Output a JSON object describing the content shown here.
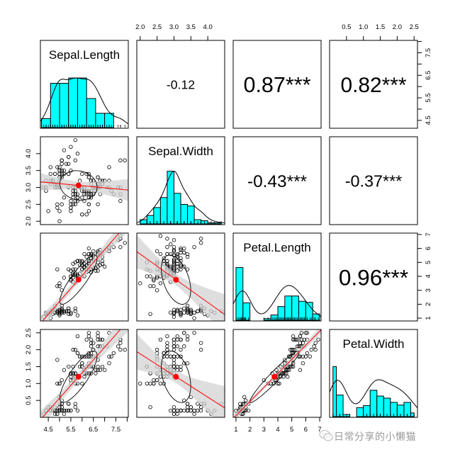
{
  "chart_data": {
    "type": "scatter",
    "title": "",
    "variables": [
      "Sepal.Length",
      "Sepal.Width",
      "Petal.Length",
      "Petal.Width"
    ],
    "ranges": {
      "Sepal.Length": [
        4.15,
        8.05
      ],
      "Sepal.Width": [
        1.9,
        4.5
      ],
      "Petal.Length": [
        0.8,
        7.1
      ],
      "Petal.Width": [
        0.0,
        2.6
      ]
    },
    "ticks": {
      "Sepal.Length": {
        "major": [
          4.5,
          5.0,
          5.5,
          6.0,
          6.5,
          7.0,
          7.5,
          8.0
        ],
        "labels": [
          "4.5",
          "5.5",
          "6.5",
          "7.5"
        ],
        "label_values": [
          4.5,
          5.5,
          6.5,
          7.5
        ]
      },
      "Sepal.Width": {
        "major": [
          2.0,
          2.5,
          3.0,
          3.5,
          4.0
        ],
        "labels": [
          "2.0",
          "2.5",
          "3.0",
          "3.5",
          "4.0"
        ],
        "label_values": [
          2.0,
          2.5,
          3.0,
          3.5,
          4.0
        ]
      },
      "Petal.Length": {
        "major": [
          1,
          2,
          3,
          4,
          5,
          6,
          7
        ],
        "labels": [
          "1",
          "2",
          "3",
          "4",
          "5",
          "6",
          "7"
        ],
        "label_values": [
          1,
          2,
          3,
          4,
          5,
          6,
          7
        ]
      },
      "Petal.Width": {
        "major": [
          0.5,
          1.0,
          1.5,
          2.0,
          2.5
        ],
        "labels": [
          "0.5",
          "1.0",
          "1.5",
          "2.0",
          "2.5"
        ],
        "label_values": [
          0.5,
          1.0,
          1.5,
          2.0,
          2.5
        ]
      }
    },
    "correlations": [
      {
        "row": 0,
        "col": 1,
        "label": "-0.12",
        "r": -0.12
      },
      {
        "row": 0,
        "col": 2,
        "label": "0.87***",
        "r": 0.87
      },
      {
        "row": 0,
        "col": 3,
        "label": "0.82***",
        "r": 0.82
      },
      {
        "row": 1,
        "col": 2,
        "label": "-0.43***",
        "r": -0.43
      },
      {
        "row": 1,
        "col": 3,
        "label": "-0.37***",
        "r": -0.37
      },
      {
        "row": 2,
        "col": 3,
        "label": "0.96***",
        "r": 0.96
      }
    ],
    "means": {
      "Sepal.Length": 5.84,
      "Sepal.Width": 3.06,
      "Petal.Length": 3.76,
      "Petal.Width": 1.2
    },
    "histograms": {
      "Sepal.Length": {
        "breaks": [
          4.2,
          4.6,
          5.0,
          5.4,
          5.8,
          6.2,
          6.6,
          7.0,
          7.4,
          7.8,
          8.2
        ],
        "rel_heights": [
          0.17,
          0.84,
          0.84,
          0.94,
          0.94,
          0.55,
          0.27,
          0.27,
          0.0,
          0.0
        ],
        "density_peak": 0.94
      },
      "Sepal.Width": {
        "breaks": [
          2.0,
          2.2,
          2.4,
          2.6,
          2.8,
          3.0,
          3.2,
          3.4,
          3.6,
          3.8,
          4.0,
          4.2,
          4.4
        ],
        "rel_heights": [
          0.08,
          0.16,
          0.31,
          0.5,
          1.0,
          0.58,
          0.37,
          0.34,
          0.08,
          0.06,
          0.02,
          0.02
        ],
        "density_peak": 1.0
      },
      "Petal.Length": {
        "breaks": [
          1.0,
          1.5,
          2.0,
          2.5,
          3.0,
          3.5,
          4.0,
          4.5,
          5.0,
          5.5,
          6.0,
          6.5,
          7.0
        ],
        "rel_heights": [
          1.0,
          0.33,
          0.0,
          0.0,
          0.03,
          0.1,
          0.26,
          0.46,
          0.46,
          0.36,
          0.34,
          0.12,
          0.09
        ],
        "density_peak": 0.66
      },
      "Petal.Width": {
        "breaks": [
          0.1,
          0.2,
          0.4,
          0.6,
          0.8,
          1.0,
          1.2,
          1.4,
          1.6,
          1.8,
          2.0,
          2.2,
          2.4,
          2.5
        ],
        "rel_heights": [
          0.95,
          0.41,
          0.04,
          0.0,
          0.17,
          0.21,
          0.5,
          0.39,
          0.35,
          0.27,
          0.22,
          0.27,
          0.07
        ],
        "density_peak": 0.7
      }
    },
    "iris": {
      "Sepal.Length": [
        5.1,
        4.9,
        4.7,
        4.6,
        5.0,
        5.4,
        4.6,
        5.0,
        4.4,
        4.9,
        5.4,
        4.8,
        4.8,
        4.3,
        5.8,
        5.7,
        5.4,
        5.1,
        5.7,
        5.1,
        5.4,
        5.1,
        4.6,
        5.1,
        4.8,
        5.0,
        5.0,
        5.2,
        5.2,
        4.7,
        4.8,
        5.4,
        5.2,
        5.5,
        4.9,
        5.0,
        5.5,
        4.9,
        4.4,
        5.1,
        5.0,
        4.5,
        4.4,
        5.0,
        5.1,
        4.8,
        5.1,
        4.6,
        5.3,
        5.0,
        7.0,
        6.4,
        6.9,
        5.5,
        6.5,
        5.7,
        6.3,
        4.9,
        6.6,
        5.2,
        5.0,
        5.9,
        6.0,
        6.1,
        5.6,
        6.7,
        5.6,
        5.8,
        6.2,
        5.6,
        5.9,
        6.1,
        6.3,
        6.1,
        6.4,
        6.6,
        6.8,
        6.7,
        6.0,
        5.7,
        5.5,
        5.5,
        5.8,
        6.0,
        5.4,
        6.0,
        6.7,
        6.3,
        5.6,
        5.5,
        5.5,
        6.1,
        5.8,
        5.0,
        5.6,
        5.7,
        5.7,
        6.2,
        5.1,
        5.7,
        6.3,
        5.8,
        7.1,
        6.3,
        6.5,
        7.6,
        4.9,
        7.3,
        6.7,
        7.2,
        6.5,
        6.4,
        6.8,
        5.7,
        5.8,
        6.4,
        6.5,
        7.7,
        7.7,
        6.0,
        6.9,
        5.6,
        7.7,
        6.3,
        6.7,
        7.2,
        6.2,
        6.1,
        6.4,
        7.2,
        7.4,
        7.9,
        6.4,
        6.3,
        6.1,
        7.7,
        6.3,
        6.4,
        6.0,
        6.9,
        6.7,
        6.9,
        5.8,
        6.8,
        6.7,
        6.7,
        6.3,
        6.5,
        6.2,
        5.9
      ],
      "Sepal.Width": [
        3.5,
        3.0,
        3.2,
        3.1,
        3.6,
        3.9,
        3.4,
        3.4,
        2.9,
        3.1,
        3.7,
        3.4,
        3.0,
        3.0,
        4.0,
        4.4,
        3.9,
        3.5,
        3.8,
        3.8,
        3.4,
        3.7,
        3.6,
        3.3,
        3.4,
        3.0,
        3.4,
        3.5,
        3.4,
        3.2,
        3.1,
        3.4,
        4.1,
        4.2,
        3.1,
        3.2,
        3.5,
        3.6,
        3.0,
        3.4,
        3.5,
        2.3,
        3.2,
        3.5,
        3.8,
        3.0,
        3.8,
        3.2,
        3.7,
        3.3,
        3.2,
        3.2,
        3.1,
        2.3,
        2.8,
        2.8,
        3.3,
        2.4,
        2.9,
        2.7,
        2.0,
        3.0,
        2.2,
        2.9,
        2.9,
        3.1,
        3.0,
        2.7,
        2.2,
        2.5,
        3.2,
        2.8,
        2.5,
        2.8,
        2.9,
        3.0,
        2.8,
        3.0,
        2.9,
        2.6,
        2.4,
        2.4,
        2.7,
        2.7,
        3.0,
        3.4,
        3.1,
        2.3,
        3.0,
        2.5,
        2.6,
        3.0,
        2.6,
        2.3,
        2.7,
        3.0,
        2.9,
        2.9,
        2.5,
        2.8,
        3.3,
        2.7,
        3.0,
        2.9,
        3.0,
        3.0,
        2.5,
        2.9,
        2.5,
        3.6,
        3.2,
        2.7,
        3.0,
        2.5,
        2.8,
        3.2,
        3.0,
        3.8,
        2.6,
        2.2,
        3.2,
        2.8,
        2.8,
        2.7,
        3.3,
        3.2,
        2.8,
        3.0,
        2.8,
        3.0,
        2.8,
        3.8,
        2.8,
        2.8,
        2.6,
        3.0,
        3.4,
        3.1,
        3.0,
        3.1,
        3.1,
        3.1,
        2.7,
        3.2,
        3.3,
        3.0,
        2.5,
        3.0,
        3.4,
        3.0
      ],
      "Petal.Length": [
        1.4,
        1.4,
        1.3,
        1.5,
        1.4,
        1.7,
        1.4,
        1.5,
        1.4,
        1.5,
        1.5,
        1.6,
        1.4,
        1.1,
        1.2,
        1.5,
        1.3,
        1.4,
        1.7,
        1.5,
        1.7,
        1.5,
        1.0,
        1.7,
        1.9,
        1.6,
        1.6,
        1.5,
        1.4,
        1.6,
        1.6,
        1.5,
        1.5,
        1.4,
        1.5,
        1.2,
        1.3,
        1.4,
        1.3,
        1.5,
        1.3,
        1.3,
        1.3,
        1.6,
        1.9,
        1.4,
        1.6,
        1.4,
        1.5,
        1.4,
        4.7,
        4.5,
        4.9,
        4.0,
        4.6,
        4.5,
        4.7,
        3.3,
        4.6,
        3.9,
        3.5,
        4.2,
        4.0,
        4.7,
        3.6,
        4.4,
        4.5,
        4.1,
        4.5,
        3.9,
        4.8,
        4.0,
        4.9,
        4.7,
        4.3,
        4.4,
        4.8,
        5.0,
        4.5,
        3.5,
        3.8,
        3.7,
        3.9,
        5.1,
        4.5,
        4.5,
        4.7,
        4.4,
        4.1,
        4.0,
        4.4,
        4.6,
        4.0,
        3.3,
        4.2,
        4.2,
        4.2,
        4.3,
        3.0,
        4.1,
        6.0,
        5.1,
        5.9,
        5.6,
        5.8,
        6.6,
        4.5,
        6.3,
        5.8,
        6.1,
        5.1,
        5.3,
        5.5,
        5.0,
        5.1,
        5.3,
        5.5,
        6.7,
        6.9,
        5.0,
        5.7,
        4.9,
        6.7,
        4.9,
        5.7,
        6.0,
        4.8,
        4.9,
        5.6,
        5.8,
        6.1,
        6.4,
        5.6,
        5.1,
        5.6,
        6.1,
        5.6,
        5.5,
        4.8,
        5.4,
        5.6,
        5.1,
        5.1,
        5.9,
        5.7,
        5.2,
        5.0,
        5.2,
        5.4,
        5.1
      ],
      "Petal.Width": [
        0.2,
        0.2,
        0.2,
        0.2,
        0.2,
        0.4,
        0.3,
        0.2,
        0.2,
        0.1,
        0.2,
        0.2,
        0.1,
        0.1,
        0.2,
        0.4,
        0.4,
        0.3,
        0.3,
        0.3,
        0.2,
        0.4,
        0.2,
        0.5,
        0.2,
        0.2,
        0.4,
        0.2,
        0.2,
        0.2,
        0.2,
        0.4,
        0.1,
        0.2,
        0.2,
        0.2,
        0.2,
        0.1,
        0.2,
        0.2,
        0.3,
        0.3,
        0.2,
        0.6,
        0.4,
        0.3,
        0.2,
        0.2,
        0.2,
        0.2,
        1.4,
        1.5,
        1.5,
        1.3,
        1.5,
        1.3,
        1.6,
        1.0,
        1.3,
        1.4,
        1.0,
        1.5,
        1.0,
        1.4,
        1.3,
        1.4,
        1.5,
        1.0,
        1.5,
        1.1,
        1.8,
        1.3,
        1.5,
        1.2,
        1.3,
        1.4,
        1.4,
        1.7,
        1.5,
        1.0,
        1.1,
        1.0,
        1.2,
        1.6,
        1.5,
        1.6,
        1.5,
        1.3,
        1.3,
        1.3,
        1.2,
        1.4,
        1.2,
        1.0,
        1.3,
        1.2,
        1.3,
        1.3,
        1.1,
        1.3,
        2.5,
        1.9,
        2.1,
        1.8,
        2.2,
        2.1,
        1.7,
        1.8,
        1.8,
        2.5,
        2.0,
        1.9,
        2.1,
        2.0,
        2.4,
        2.3,
        1.8,
        2.2,
        2.3,
        1.5,
        2.3,
        2.0,
        2.0,
        1.8,
        2.1,
        1.8,
        1.8,
        1.8,
        2.1,
        1.6,
        1.9,
        2.0,
        2.2,
        1.5,
        1.4,
        2.3,
        2.4,
        1.8,
        1.8,
        2.1,
        2.4,
        2.3,
        1.9,
        2.3,
        2.5,
        2.3,
        1.9,
        2.0,
        2.3,
        1.8
      ]
    },
    "colors": {
      "hist_fill": "#00FFFF",
      "fit_line": "#FF0000",
      "confidence_band": "#D3D3D3",
      "mean_point": "#FF0000",
      "points": "#000000"
    },
    "annotations": {
      "watermark": "日常分享的小懒猫"
    }
  }
}
